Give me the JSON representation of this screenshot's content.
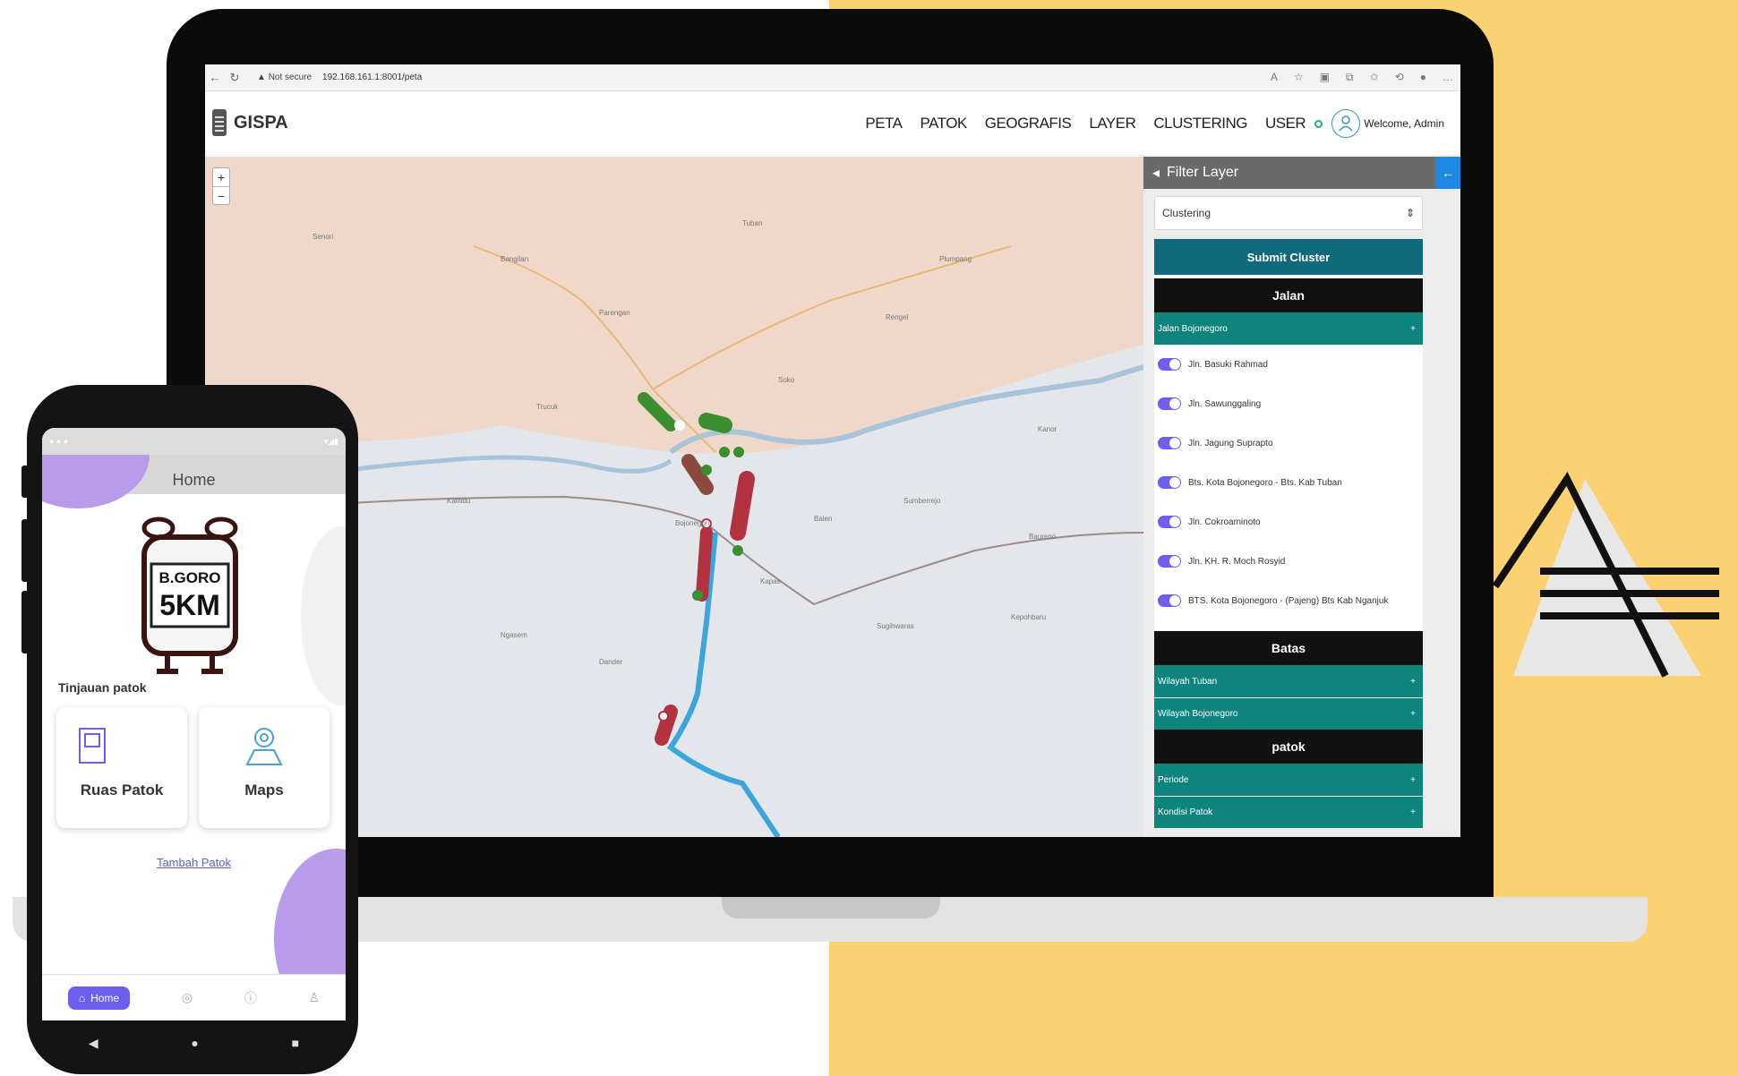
{
  "browser": {
    "warning": "Not secure",
    "url": "192.168.161.1:8001/peta",
    "back_icon": "arrow-left-icon",
    "reload_icon": "reload-icon"
  },
  "app": {
    "brand": "GISPA",
    "menu": [
      "PETA",
      "PATOK",
      "GEOGRAFIS",
      "LAYER",
      "CLUSTERING",
      "USER"
    ],
    "welcome": "Welcome, Admin"
  },
  "map": {
    "zoom_in": "+",
    "zoom_out": "−",
    "places": [
      "Senori",
      "Bangilan",
      "Parengan",
      "Tuban",
      "Plumpang",
      "Rengel",
      "Soko",
      "Kalitidu",
      "Trucuk",
      "Bojonegoro",
      "Kapas",
      "Dander",
      "Sumberrejo",
      "Kanor",
      "Baureno",
      "Balen",
      "Ngasem",
      "Sugihwaras",
      "Kepohbaru"
    ]
  },
  "filter": {
    "title": "Filter Layer",
    "select_value": "Clustering",
    "submit": "Submit Cluster",
    "section_jalan": "Jalan",
    "jalan_group": "Jalan Bojonegoro",
    "roads": [
      "Jln. Basuki Rahmad",
      "Jln. Sawunggaling",
      "Jln. Jagung Suprapto",
      "Bts. Kota Bojonegoro - Bts. Kab Tuban",
      "Jln. Cokroaminoto",
      "Jln. KH. R. Moch Rosyid",
      "BTS. Kota Bojonegoro - (Pajeng) Bts Kab Nganjuk"
    ],
    "section_batas": "Batas",
    "batas_items": [
      "Wilayah Tuban",
      "Wilayah Bojonegoro"
    ],
    "section_patok": "patok",
    "patok_items": [
      "Periode",
      "Kondisi Patok"
    ],
    "plus": "+"
  },
  "phone": {
    "title": "Home",
    "logo_line1": "B.GORO",
    "logo_line2": "5KM",
    "section": "Tinjauan patok",
    "card1": "Ruas Patok",
    "card2": "Maps",
    "link": "Tambah Patok",
    "nav_home": "Home"
  },
  "colors": {
    "accent_yellow": "#fcd172",
    "teal": "#0e857c",
    "submit_teal": "#11697e",
    "purple": "#6d5ef0",
    "road_blue": "#3aa6d9",
    "marker_green": "#3b8f2e",
    "marker_red": "#b3323f"
  }
}
